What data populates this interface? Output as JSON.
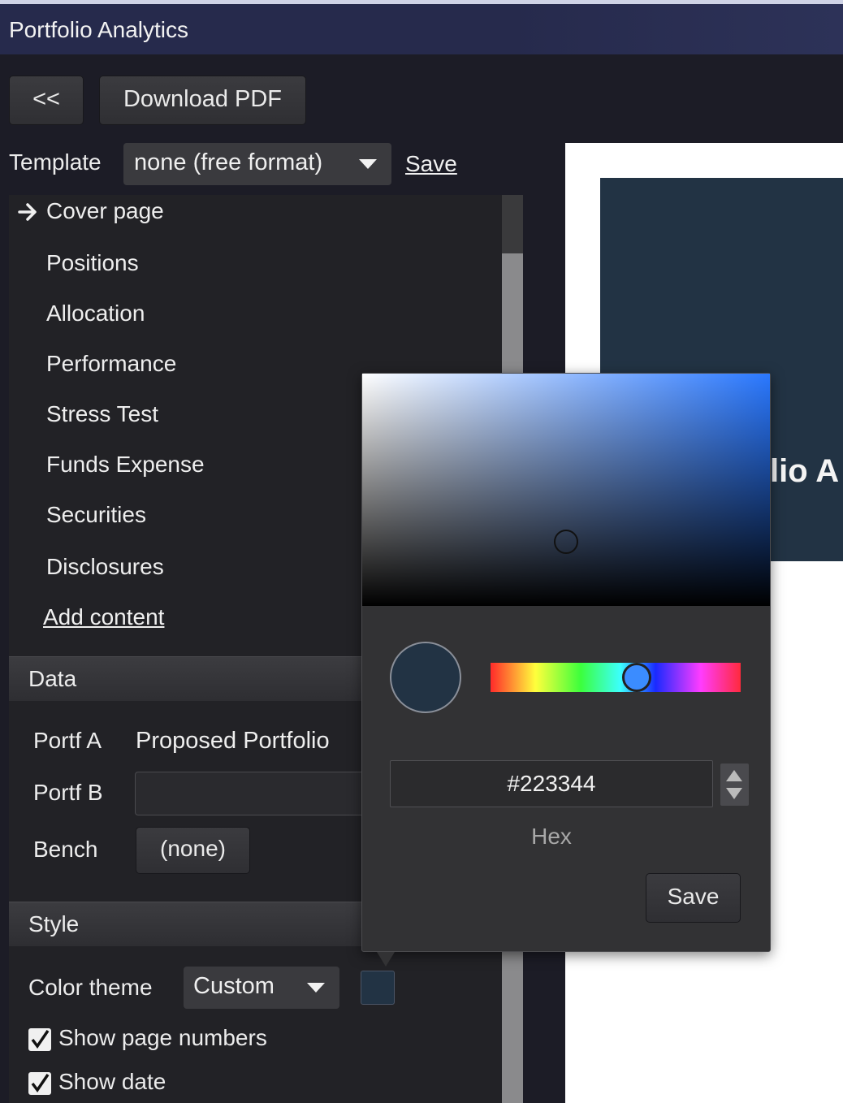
{
  "app": {
    "title": "Portfolio Analytics"
  },
  "toolbar": {
    "back_label": "<<",
    "download_label": "Download PDF"
  },
  "template": {
    "label": "Template",
    "selected": "none (free format)",
    "save_label": "Save"
  },
  "contents": {
    "items": [
      "Cover page",
      "Positions",
      "Allocation",
      "Performance",
      "Stress Test",
      "Funds Expense",
      "Securities",
      "Disclosures"
    ],
    "current_item": "Cover page",
    "add_label": "Add content"
  },
  "data_section": {
    "title": "Data",
    "portf_a_label": "Portf A",
    "portf_a_value": "Proposed Portfolio",
    "portf_b_label": "Portf B",
    "portf_b_value": "",
    "bench_label": "Bench",
    "bench_value": "(none)"
  },
  "style_section": {
    "title": "Style",
    "color_theme_label": "Color theme",
    "color_theme_value": "Custom",
    "custom_color": "#223344",
    "show_page_numbers_label": "Show page numbers",
    "show_page_numbers": true,
    "show_date_label": "Show date",
    "show_date": true
  },
  "preview": {
    "title_fragment": "lio A"
  },
  "color_picker": {
    "hex_value": "#223344",
    "hex_caption": "Hex",
    "save_label": "Save",
    "hue_base_color": "#2a78ff"
  },
  "icons": {
    "current_item_indicator": "right-arrow-icon",
    "dropdown": "chevron-down-icon",
    "checkbox": "checkmark-icon"
  }
}
